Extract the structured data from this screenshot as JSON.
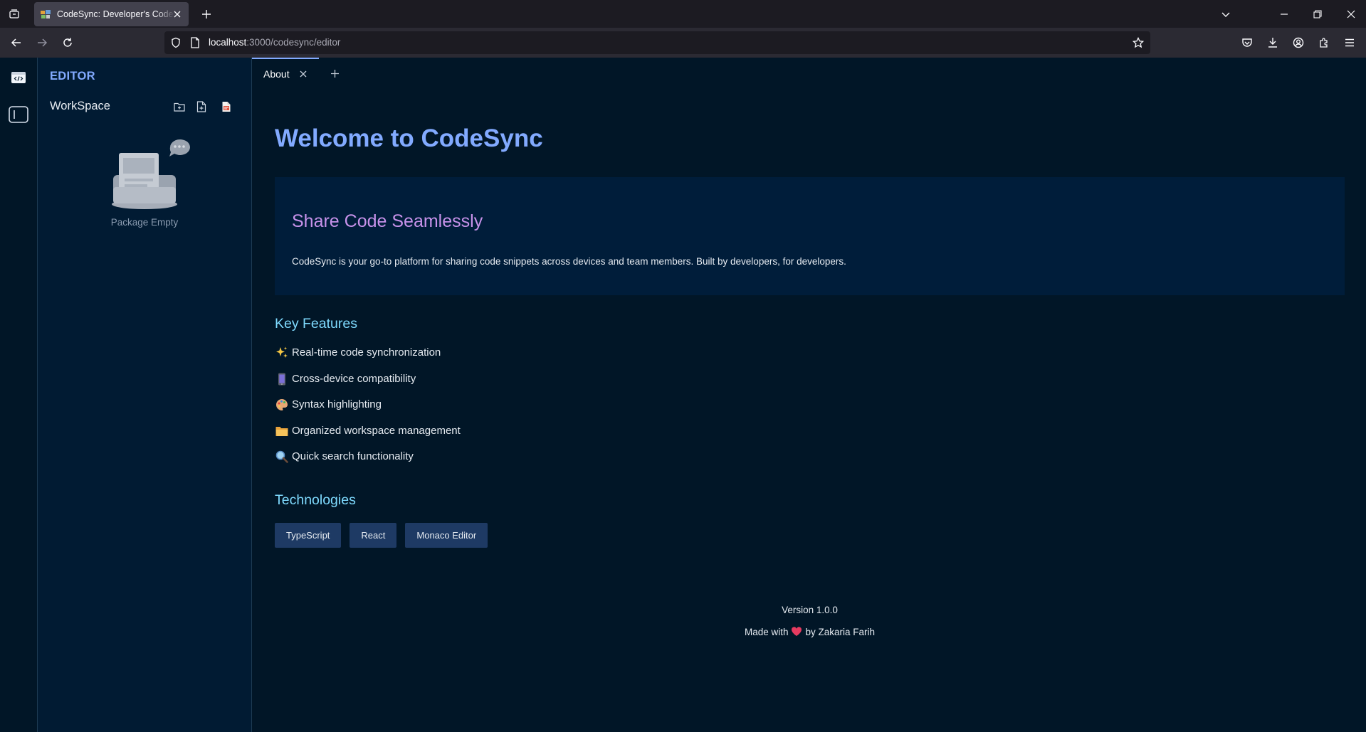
{
  "browser": {
    "tab_title": "CodeSync: Developer's Code Snippets",
    "url_host": "localhost",
    "url_path": ":3000/codesync/editor"
  },
  "sidebar": {
    "title": "EDITOR",
    "workspace_label": "WorkSpace",
    "empty_text": "Package Empty"
  },
  "editor": {
    "tabs": [
      {
        "label": "About"
      }
    ]
  },
  "about": {
    "heading": "Welcome to CodeSync",
    "hero_title": "Share Code Seamlessly",
    "hero_description": "CodeSync is your go-to platform for sharing code snippets across devices and team members. Built by developers, for developers.",
    "features_title": "Key Features",
    "features": [
      {
        "icon": "sparkles-icon",
        "label": "Real-time code synchronization"
      },
      {
        "icon": "mobile-phone-icon",
        "label": "Cross-device compatibility"
      },
      {
        "icon": "palette-icon",
        "label": "Syntax highlighting"
      },
      {
        "icon": "folder-icon",
        "label": "Organized workspace management"
      },
      {
        "icon": "magnifier-icon",
        "label": "Quick search functionality"
      }
    ],
    "technologies_title": "Technologies",
    "technologies": [
      "TypeScript",
      "React",
      "Monaco Editor"
    ],
    "version": "Version 1.0.0",
    "made_with_prefix": "Made with",
    "made_with_suffix": "by Zakaria Farih"
  },
  "colors": {
    "accent_blue": "#82aaff",
    "accent_purple": "#c792ea",
    "accent_cyan": "#7fdbff",
    "background": "#011627",
    "badge": "#1e3a64",
    "heart": "#e63b60"
  }
}
